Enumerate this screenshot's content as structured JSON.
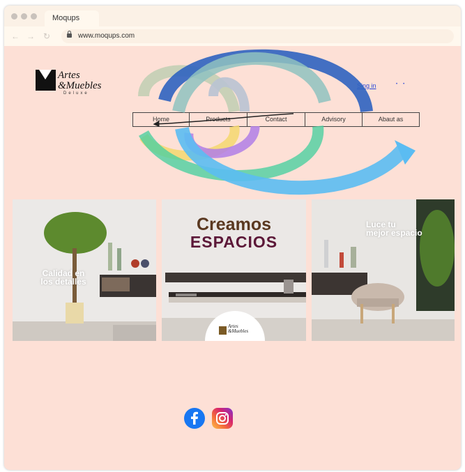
{
  "browser": {
    "tab_title": "Moqups",
    "url": "www.moqups.com",
    "back_icon": "arrow-left-icon",
    "forward_icon": "arrow-right-icon",
    "reload_icon": "reload-icon"
  },
  "header": {
    "logo": {
      "line1": "Artes",
      "line2": "&Muebles",
      "subtitle": "Deluxe"
    },
    "signin": "Sing in"
  },
  "nav": {
    "items": [
      "Home",
      "Products",
      "Contact",
      "Advisory",
      "Abaut as"
    ]
  },
  "gallery": [
    {
      "caption": [
        "Calidad en",
        "los detalles"
      ]
    },
    {
      "headline": "Creamos",
      "subheadline": "ESPACIOS",
      "badge": {
        "line1": "Artes",
        "line2": "&Muebles"
      }
    },
    {
      "caption": [
        "Luce tu",
        "mejor espacio"
      ]
    }
  ],
  "social": {
    "facebook_icon": "facebook-icon",
    "instagram_icon": "instagram-icon"
  },
  "colors": {
    "page_bg": "#fde0d6",
    "arrow_blue": "#2f63c0",
    "arrow_lightblue": "#5bbcf2",
    "arrow_teal": "#8fc2c0",
    "arrow_green": "#4cd0a0",
    "arrow_purple": "#b07ee6",
    "arrow_yellow": "#f5d76e"
  }
}
